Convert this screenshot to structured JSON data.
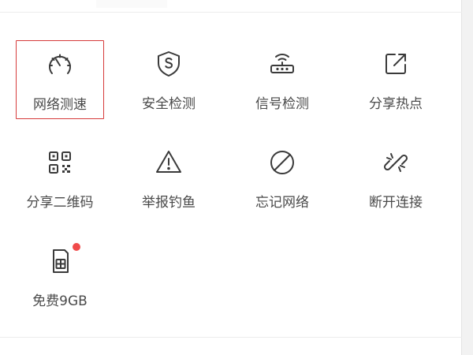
{
  "tools": [
    {
      "id": "speed-test",
      "label": "网络测速",
      "icon": "speedometer-icon",
      "selected": true
    },
    {
      "id": "security-check",
      "label": "安全检测",
      "icon": "shield-s-icon",
      "selected": false
    },
    {
      "id": "signal-check",
      "label": "信号检测",
      "icon": "router-icon",
      "selected": false
    },
    {
      "id": "share-hotspot",
      "label": "分享热点",
      "icon": "external-share-icon",
      "selected": false
    },
    {
      "id": "share-qr",
      "label": "分享二维码",
      "icon": "qr-code-icon",
      "selected": false
    },
    {
      "id": "report-phishing",
      "label": "举报钓鱼",
      "icon": "warning-triangle-icon",
      "selected": false
    },
    {
      "id": "forget-network",
      "label": "忘记网络",
      "icon": "forbidden-icon",
      "selected": false
    },
    {
      "id": "disconnect",
      "label": "断开连接",
      "icon": "broken-link-icon",
      "selected": false
    },
    {
      "id": "free-data",
      "label": "免费9GB",
      "icon": "sim-card-icon",
      "selected": false,
      "badge": true
    }
  ],
  "colors": {
    "accent_border": "#d63b3b",
    "badge": "#f04a4a",
    "icon_stroke": "#3a3a3a",
    "label_text": "#4a4a4a"
  }
}
